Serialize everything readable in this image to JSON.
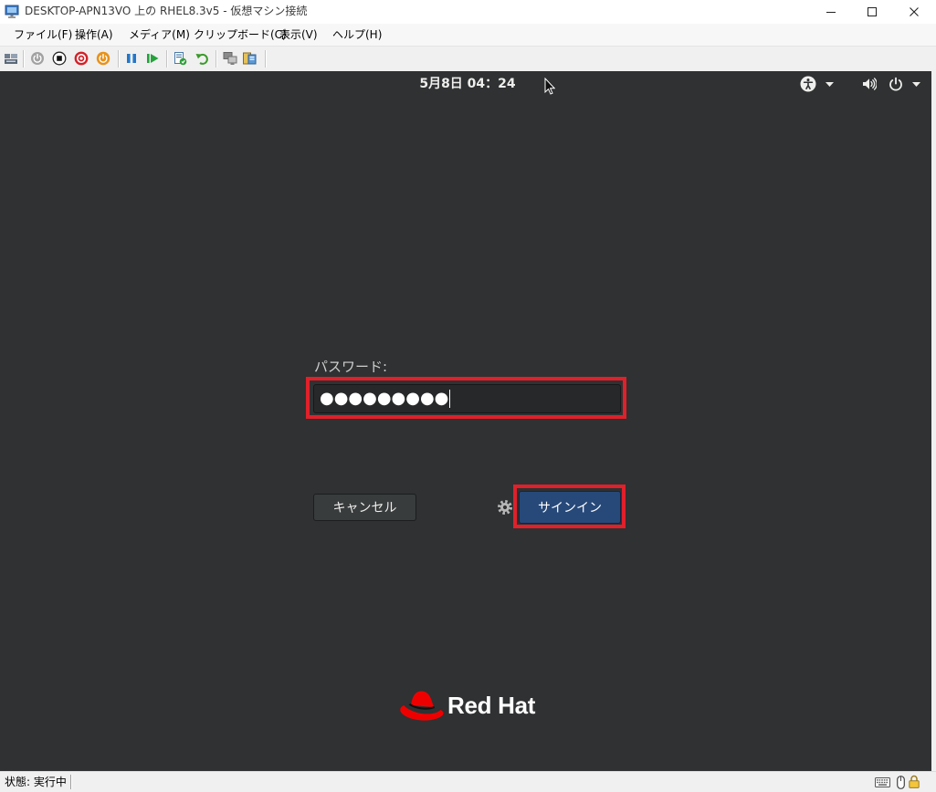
{
  "window": {
    "title": "DESKTOP-APN13VO 上の RHEL8.3v5 - 仮想マシン接続",
    "controls": [
      "minimize-icon",
      "maximize-icon",
      "close-icon"
    ]
  },
  "menu": [
    "ファイル(F)",
    "操作(A)",
    "メディア(M)",
    "クリップボード(C)",
    "表示(V)",
    "ヘルプ(H)"
  ],
  "toolbar": {
    "icons": [
      "ctrl-alt-del-icon",
      "start-icon",
      "turn-off-icon",
      "shut-down-icon",
      "save-icon",
      "pause-icon",
      "resume-icon",
      "checkpoint-icon",
      "revert-icon",
      "enhanced-session-icon",
      "share-icon"
    ]
  },
  "vm": {
    "topbar": {
      "clock": "5月8日 04：24",
      "icons": [
        "accessibility-icon",
        "volume-icon",
        "power-icon"
      ]
    },
    "login": {
      "password_label": "パスワード:",
      "password_value": "●●●●●●●●●",
      "cancel_label": "キャンセル",
      "signin_label": "サインイン",
      "settings_icon": "gear-icon"
    },
    "branding": {
      "logo_text": "Red Hat"
    }
  },
  "statusbar": {
    "status": "状態: 実行中",
    "icons": [
      "keyboard-icon",
      "mouse-icon",
      "lock-icon"
    ]
  },
  "colors": {
    "vm_background": "#2f3132",
    "highlight_box": "#e0202a",
    "signin_button": "#27497a",
    "redhat_red": "#ee0000"
  }
}
